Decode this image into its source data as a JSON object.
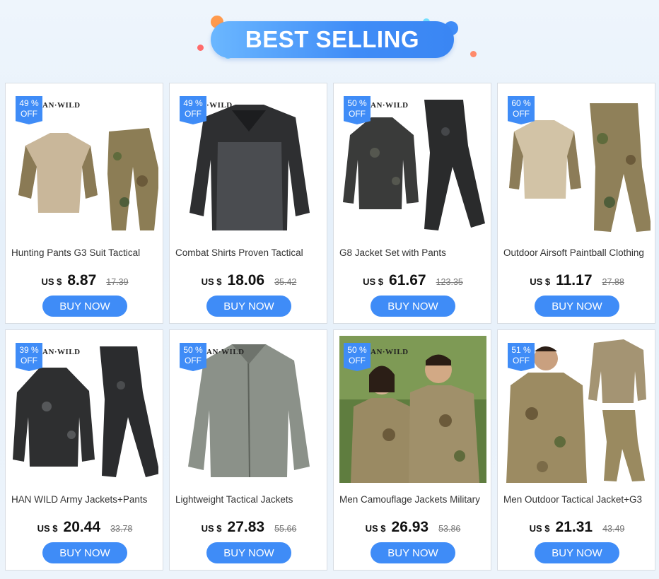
{
  "banner": {
    "title": "BEST SELLING"
  },
  "colors": {
    "accent": "#3f8cf7",
    "background": "#eaf2fb"
  },
  "products": [
    {
      "discount_pct": "49 %",
      "discount_off": "OFF",
      "brand": "AN·WILD",
      "title": "Hunting Pants G3 Suit Tactical",
      "currency": "US $",
      "price": "8.87",
      "old_price": "17.39",
      "button": "BUY NOW"
    },
    {
      "discount_pct": "49 %",
      "discount_off": "OFF",
      "brand": "·WILD",
      "title": "Combat Shirts Proven Tactical",
      "currency": "US $",
      "price": "18.06",
      "old_price": "35.42",
      "button": "BUY NOW"
    },
    {
      "discount_pct": "50 %",
      "discount_off": "OFF",
      "brand": "AN·WILD",
      "title": "G8 Jacket Set with Pants",
      "currency": "US $",
      "price": "61.67",
      "old_price": "123.35",
      "button": "BUY NOW"
    },
    {
      "discount_pct": "60 %",
      "discount_off": "OFF",
      "brand": "",
      "title": "Outdoor Airsoft Paintball Clothing",
      "currency": "US $",
      "price": "11.17",
      "old_price": "27.88",
      "button": "BUY NOW"
    },
    {
      "discount_pct": "39 %",
      "discount_off": "OFF",
      "brand": "AN·WILD",
      "title": "HAN WILD Army Jackets+Pants",
      "currency": "US $",
      "price": "20.44",
      "old_price": "33.78",
      "button": "BUY NOW"
    },
    {
      "discount_pct": "50 %",
      "discount_off": "OFF",
      "brand": "AN·WILD",
      "title": "Lightweight Tactical Jackets",
      "currency": "US $",
      "price": "27.83",
      "old_price": "55.66",
      "button": "BUY NOW"
    },
    {
      "discount_pct": "50 %",
      "discount_off": "OFF",
      "brand": "AN·WILD",
      "title": "Men Camouflage Jackets Military",
      "currency": "US $",
      "price": "26.93",
      "old_price": "53.86",
      "button": "BUY NOW"
    },
    {
      "discount_pct": "51 %",
      "discount_off": "OFF",
      "brand": "",
      "title": "Men Outdoor Tactical Jacket+G3",
      "currency": "US $",
      "price": "21.31",
      "old_price": "43.49",
      "button": "BUY NOW"
    }
  ]
}
